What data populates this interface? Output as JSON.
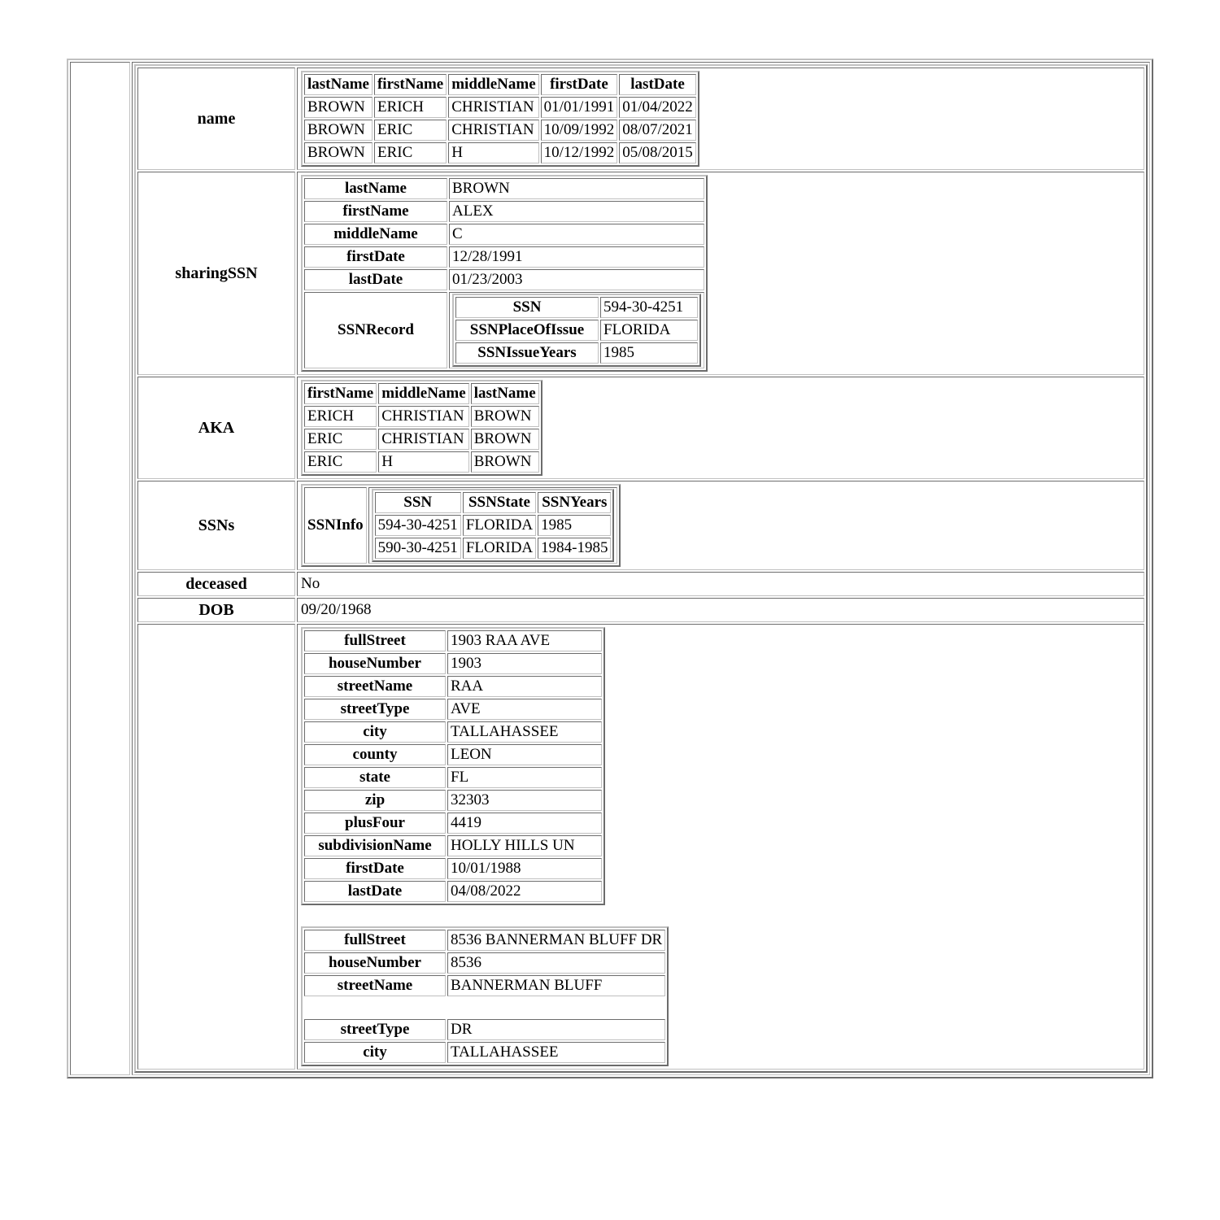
{
  "record": {
    "sections": [
      {
        "label": "name",
        "kind": "grid",
        "columns": [
          "lastName",
          "firstName",
          "middleName",
          "firstDate",
          "lastDate"
        ],
        "rows": [
          [
            "BROWN",
            "ERICH",
            "CHRISTIAN",
            "01/01/1991",
            "01/04/2022"
          ],
          [
            "BROWN",
            "ERIC",
            "CHRISTIAN",
            "10/09/1992",
            "08/07/2021"
          ],
          [
            "BROWN",
            "ERIC",
            "H",
            "10/12/1992",
            "05/08/2015"
          ]
        ]
      },
      {
        "label": "sharingSSN",
        "kind": "kv",
        "fields": [
          {
            "label": "lastName",
            "value": "BROWN"
          },
          {
            "label": "firstName",
            "value": "ALEX"
          },
          {
            "label": "middleName",
            "value": "C"
          },
          {
            "label": "firstDate",
            "value": "12/28/1991"
          },
          {
            "label": "lastDate",
            "value": "01/23/2003"
          }
        ],
        "nested": {
          "label": "SSNRecord",
          "fields": [
            {
              "label": "SSN",
              "value": "594-30-4251"
            },
            {
              "label": "SSNPlaceOfIssue",
              "value": "FLORIDA"
            },
            {
              "label": "SSNIssueYears",
              "value": "1985"
            }
          ]
        }
      },
      {
        "label": "AKA",
        "kind": "grid",
        "columns": [
          "firstName",
          "middleName",
          "lastName"
        ],
        "rows": [
          [
            "ERICH",
            "CHRISTIAN",
            "BROWN"
          ],
          [
            "ERIC",
            "CHRISTIAN",
            "BROWN"
          ],
          [
            "ERIC",
            "H",
            "BROWN"
          ]
        ]
      },
      {
        "label": "SSNs",
        "kind": "labeled-grid",
        "rowLabel": "SSNInfo",
        "columns": [
          "SSN",
          "SSNState",
          "SSNYears"
        ],
        "rows": [
          [
            "594-30-4251",
            "FLORIDA",
            "1985"
          ],
          [
            "590-30-4251",
            "FLORIDA",
            "1984-1985"
          ]
        ]
      },
      {
        "label": "deceased",
        "kind": "scalar",
        "value": "No"
      },
      {
        "label": "DOB",
        "kind": "scalar",
        "value": "09/20/1968"
      }
    ],
    "addresses_label": "",
    "addresses": [
      {
        "fields": [
          {
            "label": "fullStreet",
            "value": "1903 RAA AVE"
          },
          {
            "label": "houseNumber",
            "value": "1903"
          },
          {
            "label": "streetName",
            "value": "RAA"
          },
          {
            "label": "streetType",
            "value": "AVE"
          },
          {
            "label": "city",
            "value": "TALLAHASSEE"
          },
          {
            "label": "county",
            "value": "LEON"
          },
          {
            "label": "state",
            "value": "FL"
          },
          {
            "label": "zip",
            "value": "32303"
          },
          {
            "label": "plusFour",
            "value": "4419"
          },
          {
            "label": "subdivisionName",
            "value": "HOLLY HILLS UN"
          },
          {
            "label": "firstDate",
            "value": "10/01/1988"
          },
          {
            "label": "lastDate",
            "value": "04/08/2022"
          }
        ]
      },
      {
        "fields": [
          {
            "label": "fullStreet",
            "value": "8536 BANNERMAN BLUFF DR"
          },
          {
            "label": "houseNumber",
            "value": "8536"
          },
          {
            "label": "streetName",
            "value": "BANNERMAN BLUFF"
          },
          {
            "label": "__blank__",
            "value": ""
          },
          {
            "label": "streetType",
            "value": "DR"
          },
          {
            "label": "city",
            "value": "TALLAHASSEE"
          }
        ]
      }
    ]
  }
}
